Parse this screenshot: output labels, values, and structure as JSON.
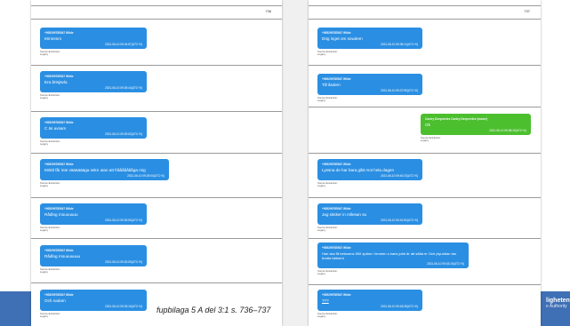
{
  "caption": "fupbilaga 5 A del 3:1 s. 736–737",
  "logo": {
    "line1": "ligheten",
    "line2": "e Authority"
  },
  "extraction": {
    "line1": "Source Extraction:",
    "line2": "Legacy"
  },
  "left_page": {
    "page_number": "736",
    "messages": [
      {
        "sender": "+905299785547 Wilde",
        "text": "Mmmmm",
        "timestamp": "2021-06-10 09:24:57(UTC+0)"
      },
      {
        "sender": "+905299785547 Wilde",
        "text": "Era årtsjävla",
        "timestamp": "2021-06-10 09:25:44(UTC+0)"
      },
      {
        "sender": "+905299785547 Wilde",
        "text": "C äs avsam",
        "timestamp": "2021-06-10 09:25:53(UTC+0)"
      },
      {
        "sender": "+905299785547 Wilde",
        "text": "Mölöl får inte vääääääga sekn utan att fråååååååga mig",
        "timestamp": "2021-06-10 09:29:00(UTC+0)"
      },
      {
        "sender": "+905299785547 Wilde",
        "text": "Rådlng mouuuuuu",
        "timestamp": "2021-06-10 09:30:05(UTC+0)"
      },
      {
        "sender": "+905299785547 Wilde",
        "text": "Rådlng mouuuuuuu",
        "timestamp": "2021-06-10 09:32:09(UTC+0)"
      },
      {
        "sender": "+905299785547 Wilde",
        "text": "Och nadam",
        "timestamp": "2021-06-10 09:33:15(UTC+0)"
      }
    ]
  },
  "right_page": {
    "page_number": "737",
    "messages": [
      {
        "sender": "+905299785547 Wilde",
        "text": "Dög inget om sowdem",
        "timestamp": "2021-06-10 09:35:14(UTC+0)",
        "color": "blue"
      },
      {
        "sender": "+905299785547 Wilde",
        "text": "Till åsdem",
        "timestamp": "2021-06-10 09:37:59(UTC+0)",
        "color": "blue"
      },
      {
        "sender": "Contry Deepvertex Contry Deepvertex (owner)",
        "text": "Ok",
        "timestamp": "2021-06-10 09:38:15(UTC+0)",
        "color": "green"
      },
      {
        "sender": "+905299785547 Wilde",
        "text": "Lyssna de har bara gått mot hela dagen",
        "timestamp": "2021-06-10 09:40:23(UTC+0)",
        "color": "blue"
      },
      {
        "sender": "+905299785547 Wilde",
        "text": "Jag sitsker in mllesan su",
        "timestamp": "2021-06-10 09:42:50(UTC+0)",
        "color": "blue"
      },
      {
        "sender": "+905299785547 Wilde",
        "text": "Han ska få betsoens 500 spänn i timmen o kans jobb är att sätta er Och plyuddan tas bratta fattnent",
        "timestamp": "2021-06-10 09:43:19(UTC+0)",
        "color": "blue"
      },
      {
        "sender": "+905299785547 Wilde",
        "text": "???",
        "timestamp": "2021-06-10 09:43:28(UTC+0)",
        "color": "blue"
      }
    ]
  }
}
